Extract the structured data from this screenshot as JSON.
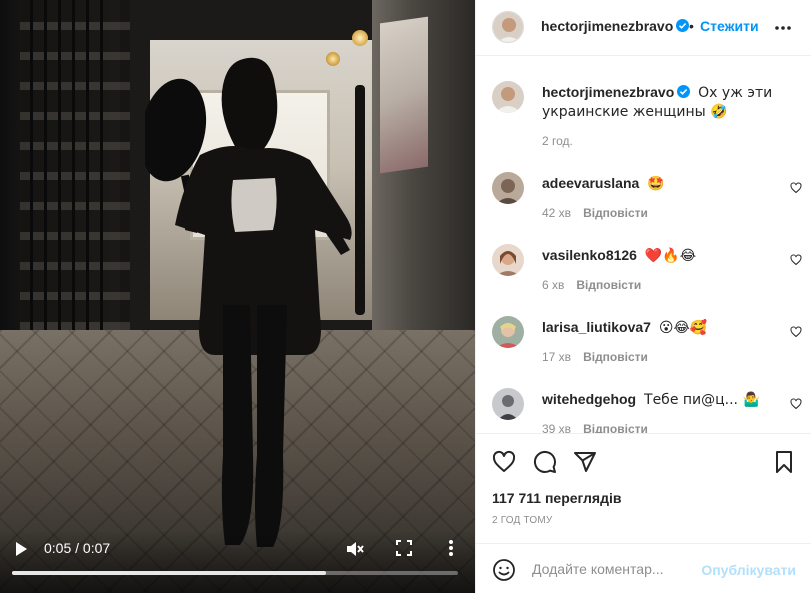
{
  "video": {
    "time": "0:05 / 0:07",
    "progress_fraction": 0.705
  },
  "header": {
    "username": "hectorjimenezbravo",
    "separator": "•",
    "follow_label": "Стежити"
  },
  "caption": {
    "username": "hectorjimenezbravo",
    "text": "Ох уж эти украинские женщины 🤣",
    "time": "2 год."
  },
  "comments": [
    {
      "username": "adeevaruslana",
      "text": "🤩",
      "time": "42 хв",
      "reply": "Відповісти"
    },
    {
      "username": "vasilenko8126",
      "text": "❤️🔥😂",
      "time": "6 хв",
      "reply": "Відповісти"
    },
    {
      "username": "larisa_liutikova7",
      "text": "😮😂🥰",
      "time": "17 хв",
      "reply": "Відповісти"
    },
    {
      "username": "witehedgehog",
      "text": "Тебе пи@ц... 🤷‍♂️",
      "time": "39 хв",
      "reply": "Відповісти"
    }
  ],
  "stats": {
    "views": "117 711 переглядів",
    "posted": "2 ГОД ТОМУ"
  },
  "composer": {
    "placeholder": "Додайте коментар...",
    "publish_label": "Опублікувати"
  },
  "colors": {
    "accent": "#0095f6",
    "publish_disabled": "#b2dffc",
    "muted_text": "#8e8e8e"
  }
}
